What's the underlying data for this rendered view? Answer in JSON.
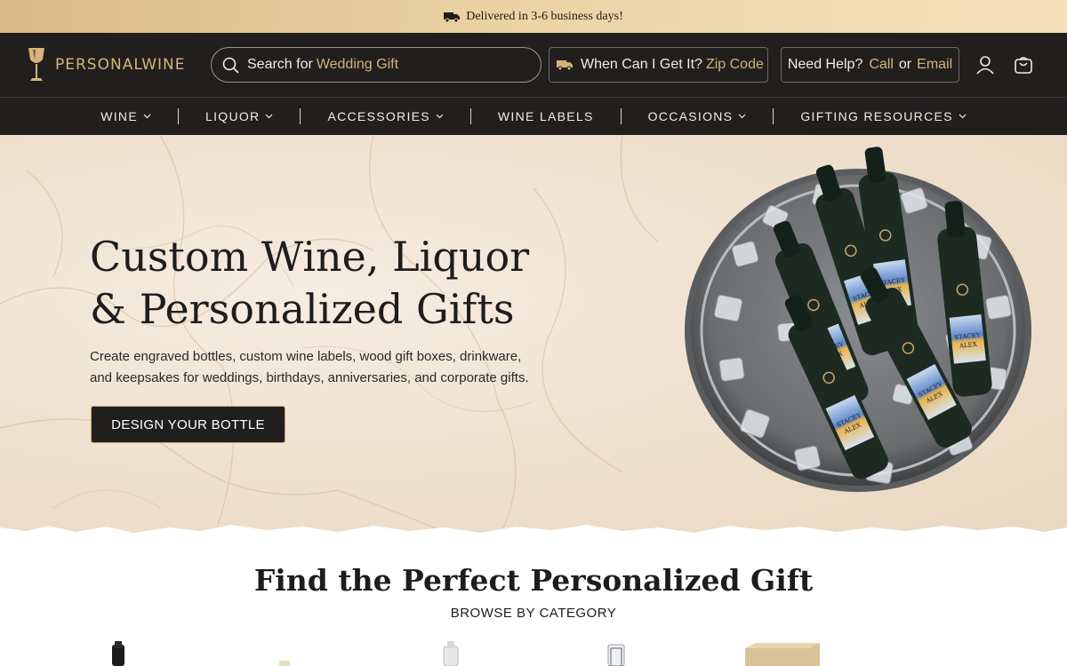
{
  "announcement": {
    "text": "Delivered in 3-6 business days!"
  },
  "header": {
    "logo": "PERSONALWINE",
    "search": {
      "prefix": "Search for",
      "suggestion": "Wedding Gift"
    },
    "zip": {
      "prefix": "When Can I Get It?",
      "link": "Zip Code"
    },
    "help": {
      "prefix": "Need Help?",
      "call": "Call",
      "or": "or",
      "email": "Email"
    }
  },
  "nav": {
    "items": [
      {
        "label": "WINE",
        "dropdown": true
      },
      {
        "label": "LIQUOR",
        "dropdown": true
      },
      {
        "label": "ACCESSORIES",
        "dropdown": true
      },
      {
        "label": "WINE LABELS",
        "dropdown": false
      },
      {
        "label": "OCCASIONS",
        "dropdown": true
      },
      {
        "label": "GIFTING RESOURCES",
        "dropdown": true
      }
    ]
  },
  "hero": {
    "title_line1": "Custom Wine, Liquor",
    "title_line2": "& Personalized Gifts",
    "subtitle_line1": "Create engraved bottles, custom wine labels, wood gift boxes, drinkware,",
    "subtitle_line2": "and keepsakes for weddings, birthdays, anniversaries, and corporate gifts.",
    "cta": "DESIGN YOUR BOTTLE",
    "bottle_label_line1": "STACEY",
    "bottle_label_line2": "ALEX"
  },
  "category": {
    "title": "Find the Perfect Personalized Gift",
    "subtitle": "BROWSE BY CATEGORY"
  },
  "colors": {
    "header_bg": "#211f1e",
    "gold": "#d5b37a",
    "announcement_bg": "#e8cc98",
    "hero_bg": "#f0e2d1"
  }
}
